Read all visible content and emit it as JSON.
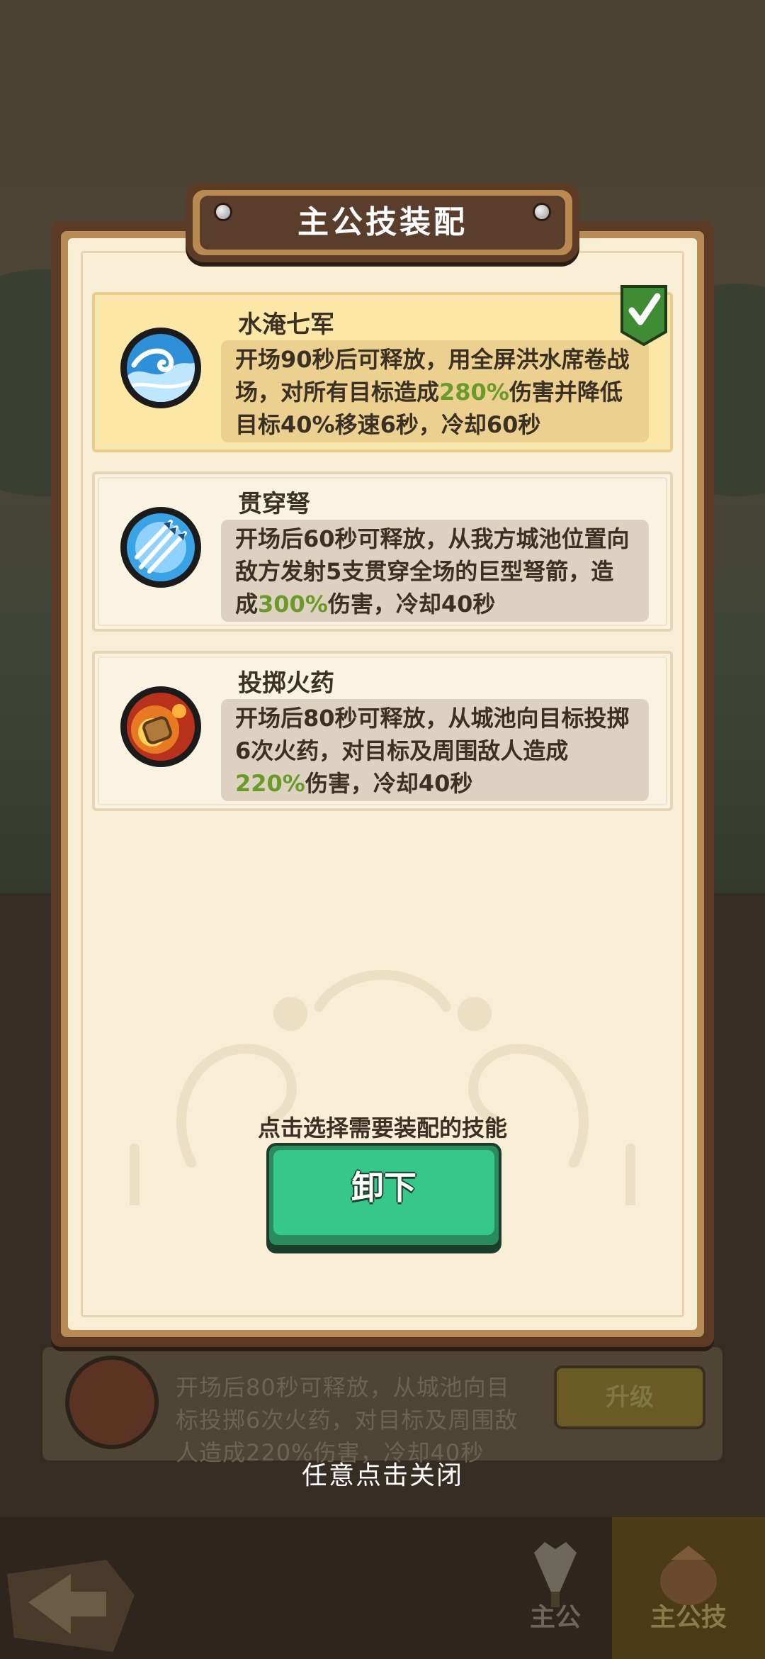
{
  "dialog": {
    "title": "主公技装配",
    "hint": "点击选择需要装配的技能",
    "unequip_label": "卸下"
  },
  "skills": [
    {
      "name": "水淹七军",
      "icon": "wave-icon",
      "selected": true,
      "desc_before": "开场90秒后可释放，用全屏洪水席卷战场，对所有目标造成",
      "desc_highlight": "280%",
      "desc_after": "伤害并降低目标40%移速6秒，冷却60秒"
    },
    {
      "name": "贯穿弩",
      "icon": "crossbow-bolts-icon",
      "selected": false,
      "desc_before": "开场后60秒可释放，从我方城池位置向敌方发射5支贯穿全场的巨型弩箭，造成",
      "desc_highlight": "300%",
      "desc_after": "伤害，冷却40秒"
    },
    {
      "name": "投掷火药",
      "icon": "gunpowder-barrel-icon",
      "selected": false,
      "desc_before": "开场后80秒可释放，从城池向目标投掷6次火药，对目标及周围敌人造成",
      "desc_highlight": "220%",
      "desc_after": "伤害，冷却40秒"
    }
  ],
  "background": {
    "card_text_line1": "开场后80秒可释放，从城池向目",
    "card_text_line2": "标投掷6次火药，对目标及周围敌",
    "card_text_line3": "人造成220%伤害，冷却40秒",
    "upgrade_label": "升级",
    "tab_lord": "主公",
    "tab_lord_skill": "主公技"
  },
  "close_hint": "任意点击关闭"
}
